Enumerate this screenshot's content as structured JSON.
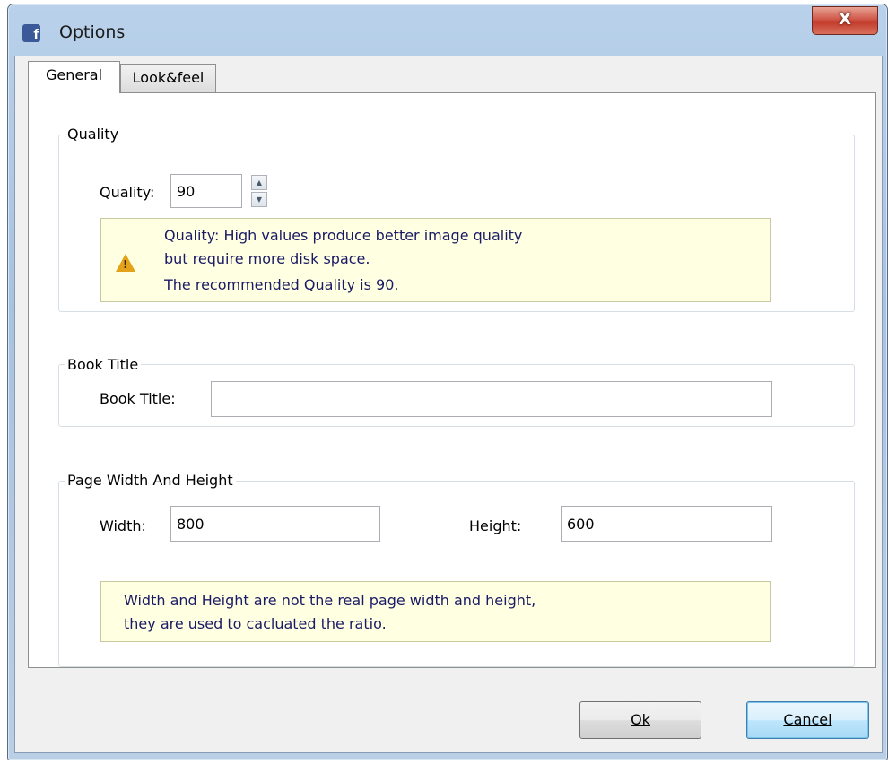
{
  "window": {
    "title": "Options",
    "close_label": "X",
    "app_icon": "facebook-f-icon"
  },
  "tabs": [
    {
      "label": "General",
      "active": true
    },
    {
      "label": "Look&feel",
      "active": false
    }
  ],
  "quality": {
    "group_title": "Quality",
    "label": "Quality:",
    "value": "90",
    "note_line1": "Quality: High values produce better image quality",
    "note_line2": "but require more disk space.",
    "note_line3": "The recommended Quality is 90.",
    "note_icon": "warning-icon"
  },
  "book_title": {
    "group_title": "Book Title",
    "label": "Book Title:",
    "value": ""
  },
  "page_size": {
    "group_title": "Page Width And Height",
    "width_label": "Width:",
    "width_value": "800",
    "height_label": "Height:",
    "height_value": "600",
    "note_line1": "Width and Height are not the real page width and height,",
    "note_line2": "they are used to cacluated the ratio."
  },
  "buttons": {
    "ok": "Ok",
    "cancel": "Cancel"
  },
  "colors": {
    "note_bg": "#ffffe1",
    "note_text": "#1a1a66",
    "warning": "#e3a21a",
    "close": "#c23b2a"
  }
}
